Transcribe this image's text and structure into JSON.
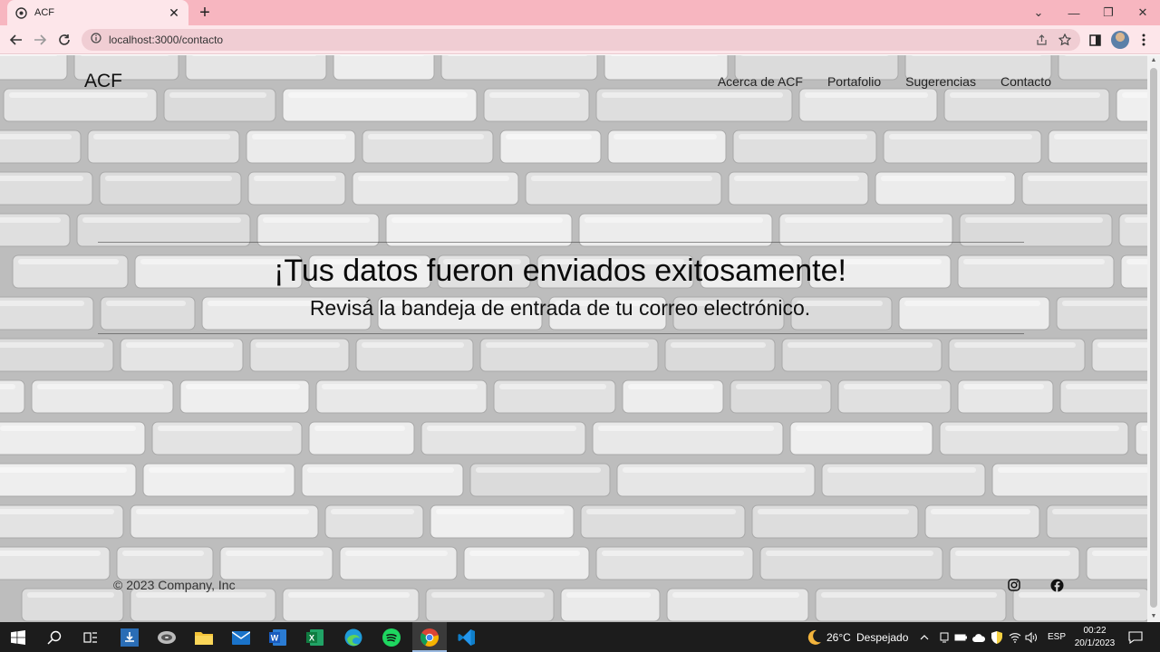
{
  "browser": {
    "tab_title": "ACF",
    "url": "localhost:3000/contacto",
    "new_tab_symbol": "+",
    "tab_close_symbol": "✕"
  },
  "page": {
    "brand": "ACF",
    "nav": [
      "Acerca de ACF",
      "Portafolio",
      "Sugerencias",
      "Contacto"
    ],
    "headline": "¡Tus datos fueron enviados exitosamente!",
    "subline": "Revisá la bandeja de entrada de tu correo electrónico.",
    "footer_copy": "© 2023 Company, Inc",
    "social_icons": [
      "instagram-icon",
      "facebook-icon"
    ]
  },
  "taskbar": {
    "apps": [
      "windows-start-icon",
      "search-icon",
      "task-view-icon",
      "file-transfer-app-icon",
      "disk-app-icon",
      "file-explorer-icon",
      "mail-icon",
      "word-icon",
      "excel-icon",
      "edge-icon",
      "spotify-icon",
      "chrome-icon",
      "vscode-icon"
    ],
    "weather_temp": "26°C",
    "weather_desc": "Despejado",
    "language": "ESP",
    "time": "00:22",
    "date": "20/1/2023"
  },
  "colors": {
    "tab_strip": "#f7b6c0",
    "toolbar": "#fde6ea",
    "wall": "#cfcfcf",
    "taskbar": "#1c1c1c"
  }
}
